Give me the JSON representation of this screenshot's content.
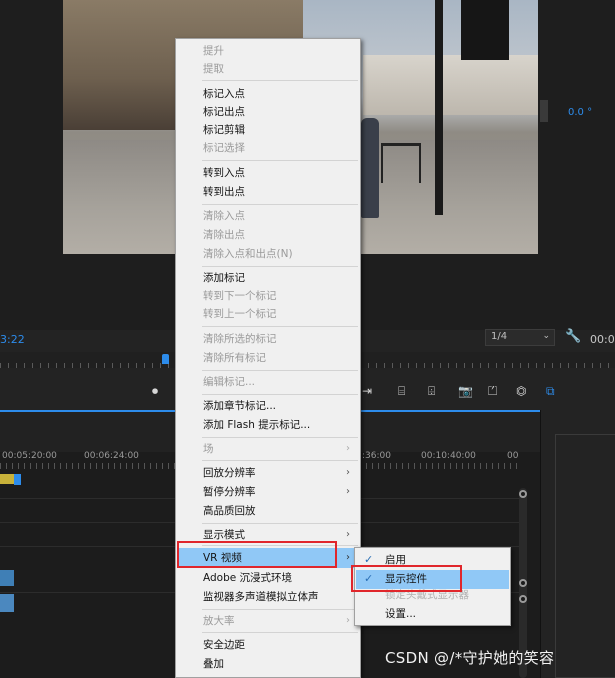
{
  "monitor": {
    "vr_readout": "0.0 °",
    "timecode_left": "3:22",
    "zoom_value": "1/4",
    "zoom_chevron": "⌄",
    "wrench_glyph": "🔧",
    "timecode_right": "00:0"
  },
  "transport_glyphs": [
    "⏺",
    "⇥",
    "⌸",
    "⌹",
    "📷",
    "⏍",
    "⏣",
    "⧉"
  ],
  "timeline": {
    "times": [
      "00:05:20:00",
      "00:06:24:00",
      ":36:00",
      "00:10:40:00",
      "00"
    ]
  },
  "menu": {
    "items": [
      {
        "label": "提升",
        "disabled": true
      },
      {
        "label": "提取",
        "disabled": true
      },
      {
        "label": "标记入点",
        "disabled": false
      },
      {
        "label": "标记出点",
        "disabled": false
      },
      {
        "label": "标记剪辑",
        "disabled": false
      },
      {
        "label": "标记选择",
        "disabled": true
      },
      {
        "label": "转到入点",
        "disabled": false
      },
      {
        "label": "转到出点",
        "disabled": false
      },
      {
        "label": "清除入点",
        "disabled": true
      },
      {
        "label": "清除出点",
        "disabled": true
      },
      {
        "label": "清除入点和出点(N)",
        "disabled": true
      },
      {
        "label": "添加标记",
        "disabled": false
      },
      {
        "label": "转到下一个标记",
        "disabled": true
      },
      {
        "label": "转到上一个标记",
        "disabled": true
      },
      {
        "label": "清除所选的标记",
        "disabled": true
      },
      {
        "label": "清除所有标记",
        "disabled": true
      },
      {
        "label": "编辑标记...",
        "disabled": true
      },
      {
        "label": "添加章节标记...",
        "disabled": false
      },
      {
        "label": "添加 Flash 提示标记...",
        "disabled": false
      },
      {
        "label": "场",
        "disabled": true
      },
      {
        "label": "回放分辨率",
        "disabled": false
      },
      {
        "label": "暂停分辨率",
        "disabled": false
      },
      {
        "label": "高品质回放",
        "disabled": false
      },
      {
        "label": "显示模式",
        "disabled": false
      },
      {
        "label": "VR 视频",
        "disabled": false
      },
      {
        "label": "Adobe 沉浸式环境",
        "disabled": false
      },
      {
        "label": "监视器多声道模拟立体声",
        "disabled": false
      },
      {
        "label": "放大率",
        "disabled": true
      },
      {
        "label": "安全边距",
        "disabled": false
      },
      {
        "label": "叠加",
        "disabled": false
      }
    ],
    "arrow": "›"
  },
  "submenu": {
    "items": [
      {
        "label": "启用",
        "checked": true
      },
      {
        "label": "显示控件",
        "checked": true
      },
      {
        "label": "锁定头戴式显示器",
        "checked": false
      },
      {
        "label": "设置...",
        "checked": false
      }
    ],
    "check": "✓"
  },
  "watermark": "CSDN @/*守护她的笑容",
  "colors": {
    "accent": "#2d8ceb",
    "highlight": "#90c8f6",
    "annotation_red": "#e0262b"
  }
}
